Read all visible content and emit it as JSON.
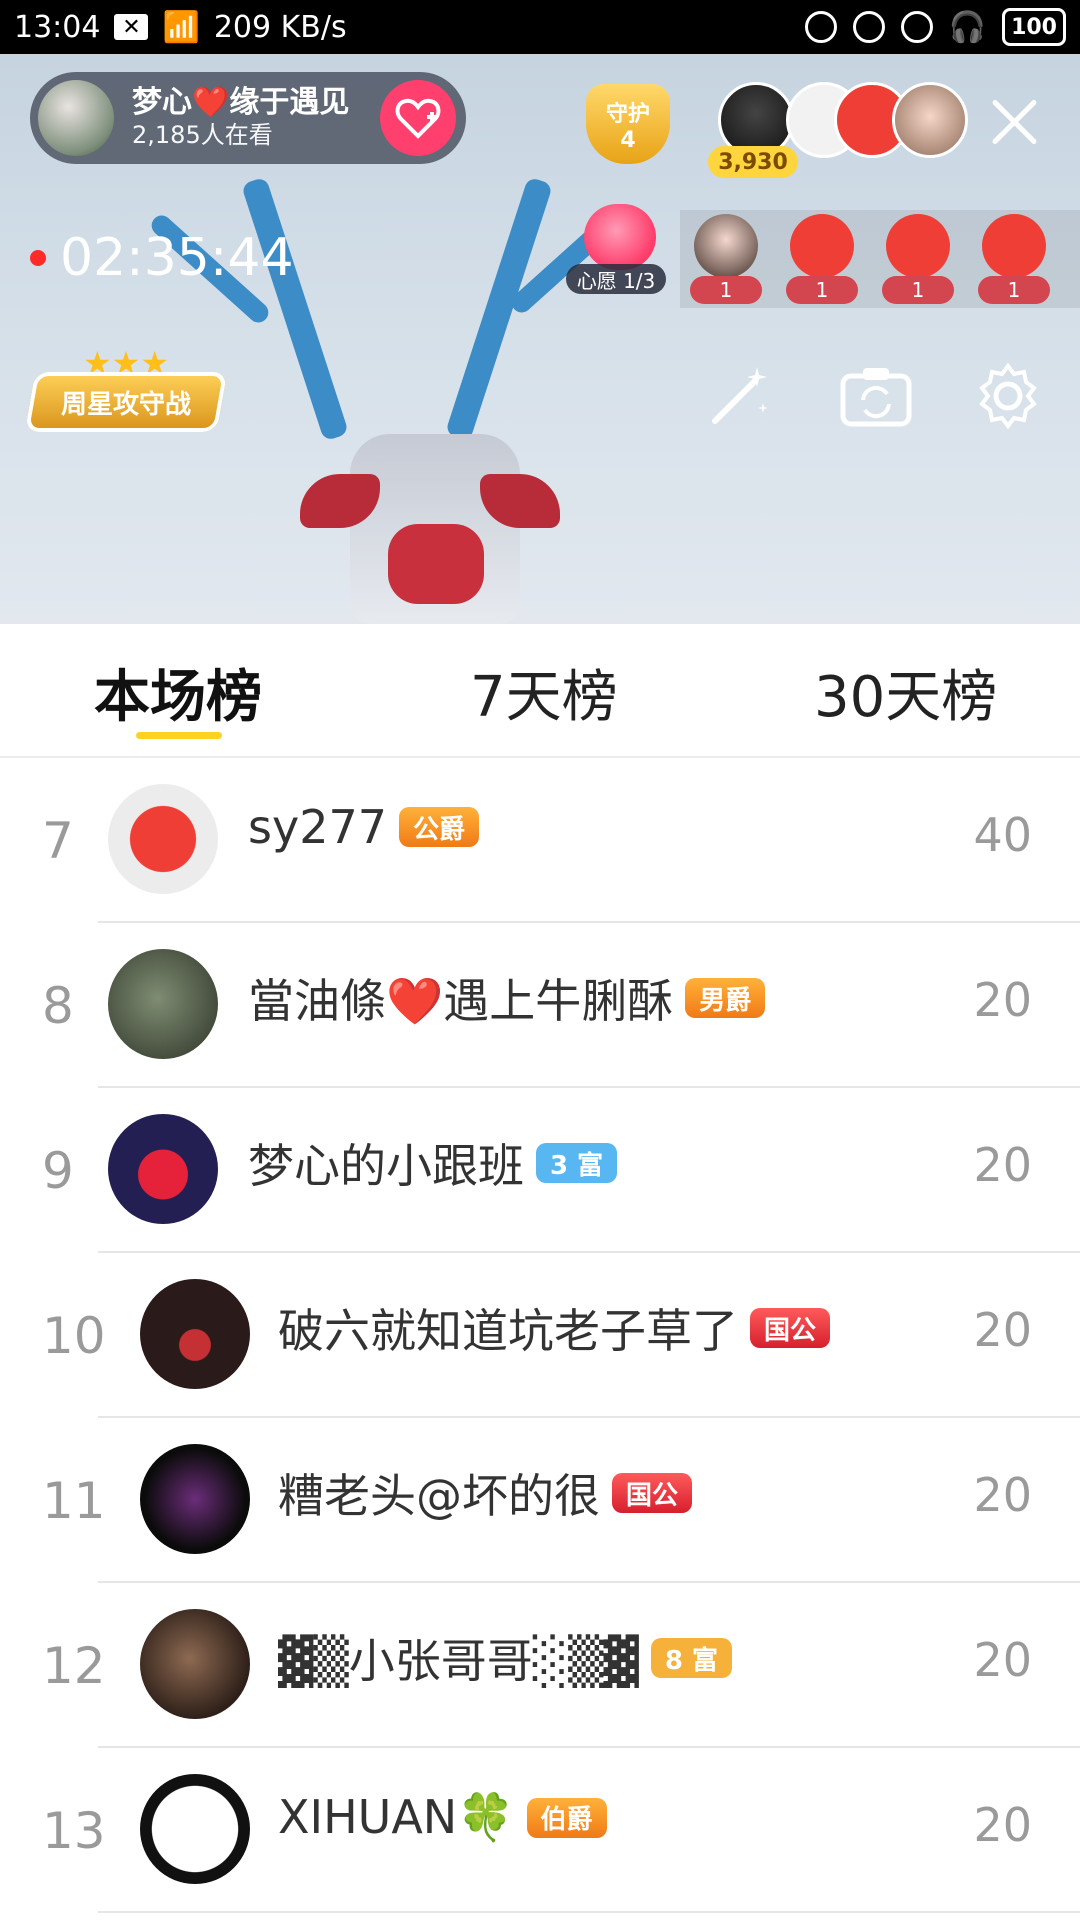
{
  "status_bar": {
    "time": "13:04",
    "network_speed": "209 KB/s",
    "battery": "100"
  },
  "live_room": {
    "host_name": "梦心❤️缘于遇见",
    "viewers": "2,185人在看",
    "guard_label": "守护",
    "guard_count": "4",
    "top_fan_score": "3,930",
    "live_time": "02:35:44",
    "wish_label": "心愿 1/3",
    "fan_scores": [
      "1",
      "1",
      "1",
      "1"
    ],
    "week_star_label": "周星攻守战"
  },
  "tabs": [
    {
      "label": "本场榜",
      "active": true
    },
    {
      "label": "7天榜",
      "active": false
    },
    {
      "label": "30天榜",
      "active": false
    }
  ],
  "ranking": [
    {
      "rank": "7",
      "name": "sy277",
      "badge": "公爵",
      "badge_color": "orange",
      "score": "40"
    },
    {
      "rank": "8",
      "name": "當油條❤️遇上牛脷酥",
      "badge": "男爵",
      "badge_color": "orange",
      "score": "20"
    },
    {
      "rank": "9",
      "name": "梦心的小跟班",
      "badge": "3 富",
      "badge_color": "blue",
      "score": "20"
    },
    {
      "rank": "10",
      "name": "破六就知道坑老子草了",
      "badge": "国公",
      "badge_color": "red",
      "score": "20"
    },
    {
      "rank": "11",
      "name": "糟老头@坏的很",
      "badge": "国公",
      "badge_color": "red",
      "score": "20"
    },
    {
      "rank": "12",
      "name": "▓▒小张哥哥░▒▓",
      "badge": "8 富",
      "badge_color": "amber",
      "score": "20"
    },
    {
      "rank": "13",
      "name": "XIHUAN🍀",
      "badge": "伯爵",
      "badge_color": "orange",
      "score": "20"
    }
  ],
  "colors": {
    "tab_indicator": "#ffd21f",
    "follow_button": "#ff3f6e",
    "rec_dot": "#ff2a2a"
  }
}
